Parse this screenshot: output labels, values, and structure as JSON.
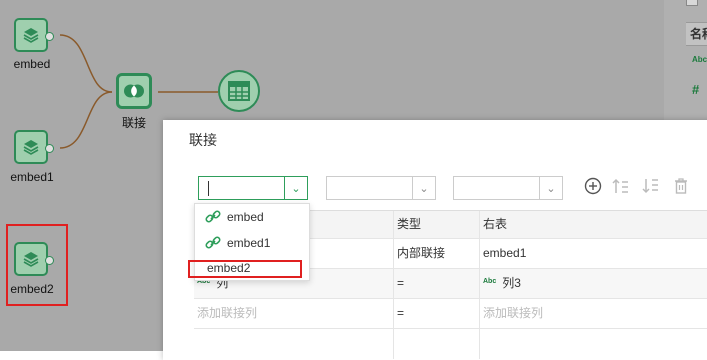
{
  "canvas": {
    "nodes": {
      "embed_a": "embed",
      "embed_b": "embed1",
      "embed_c": "embed2",
      "join": "联接"
    },
    "right_panel_header": "名称",
    "right_panel_type_icons": [
      "Abc",
      "#",
      "#"
    ]
  },
  "dialog": {
    "title": "联接",
    "left_select_value": "",
    "toolbar_icons": [
      "add-icon",
      "move-up-icon",
      "move-down-icon",
      "delete-icon"
    ],
    "columns": [
      "类型",
      "右表"
    ],
    "rows": [
      {
        "left": "",
        "type": "内部联接",
        "right": "embed1",
        "right_abc": false
      },
      {
        "left": "列",
        "left_abc": true,
        "type": "=",
        "right": "列3",
        "right_abc": true
      },
      {
        "left": "添加联接列",
        "type": "=",
        "right": "添加联接列",
        "placeholder": true
      }
    ],
    "dropdown_options": [
      "embed",
      "embed1",
      "embed2"
    ]
  },
  "colors": {
    "node_border": "#2e8b57",
    "node_fill": "#9fcfae",
    "highlight": "#e02020",
    "accent": "#2e9e5b"
  }
}
